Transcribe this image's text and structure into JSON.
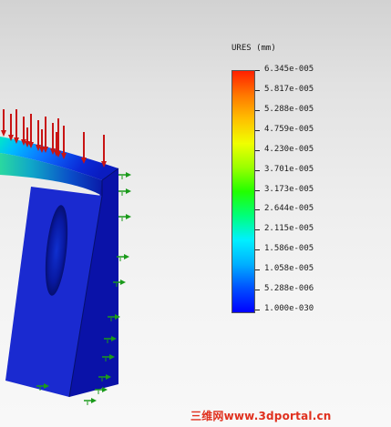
{
  "legend": {
    "title": "URES (mm)",
    "colormap": [
      "#0000ff",
      "#0050ff",
      "#00b0ff",
      "#00f0ff",
      "#00ff7a",
      "#22ff00",
      "#9aff00",
      "#f0ff00",
      "#ffc000",
      "#ff7800",
      "#ff2000"
    ],
    "ticks": [
      "6.345e-005",
      "5.817e-005",
      "5.288e-005",
      "4.759e-005",
      "4.230e-005",
      "3.701e-005",
      "3.173e-005",
      "2.644e-005",
      "2.115e-005",
      "1.586e-005",
      "1.058e-005",
      "5.288e-006",
      "1.000e-030"
    ]
  },
  "model": {
    "load_arrow_color": "#c81414",
    "fixture_arrow_color": "#1a9a1a",
    "part_color": "#1a2ac8"
  },
  "watermark": {
    "text": "三维网www.3dportal.cn"
  }
}
